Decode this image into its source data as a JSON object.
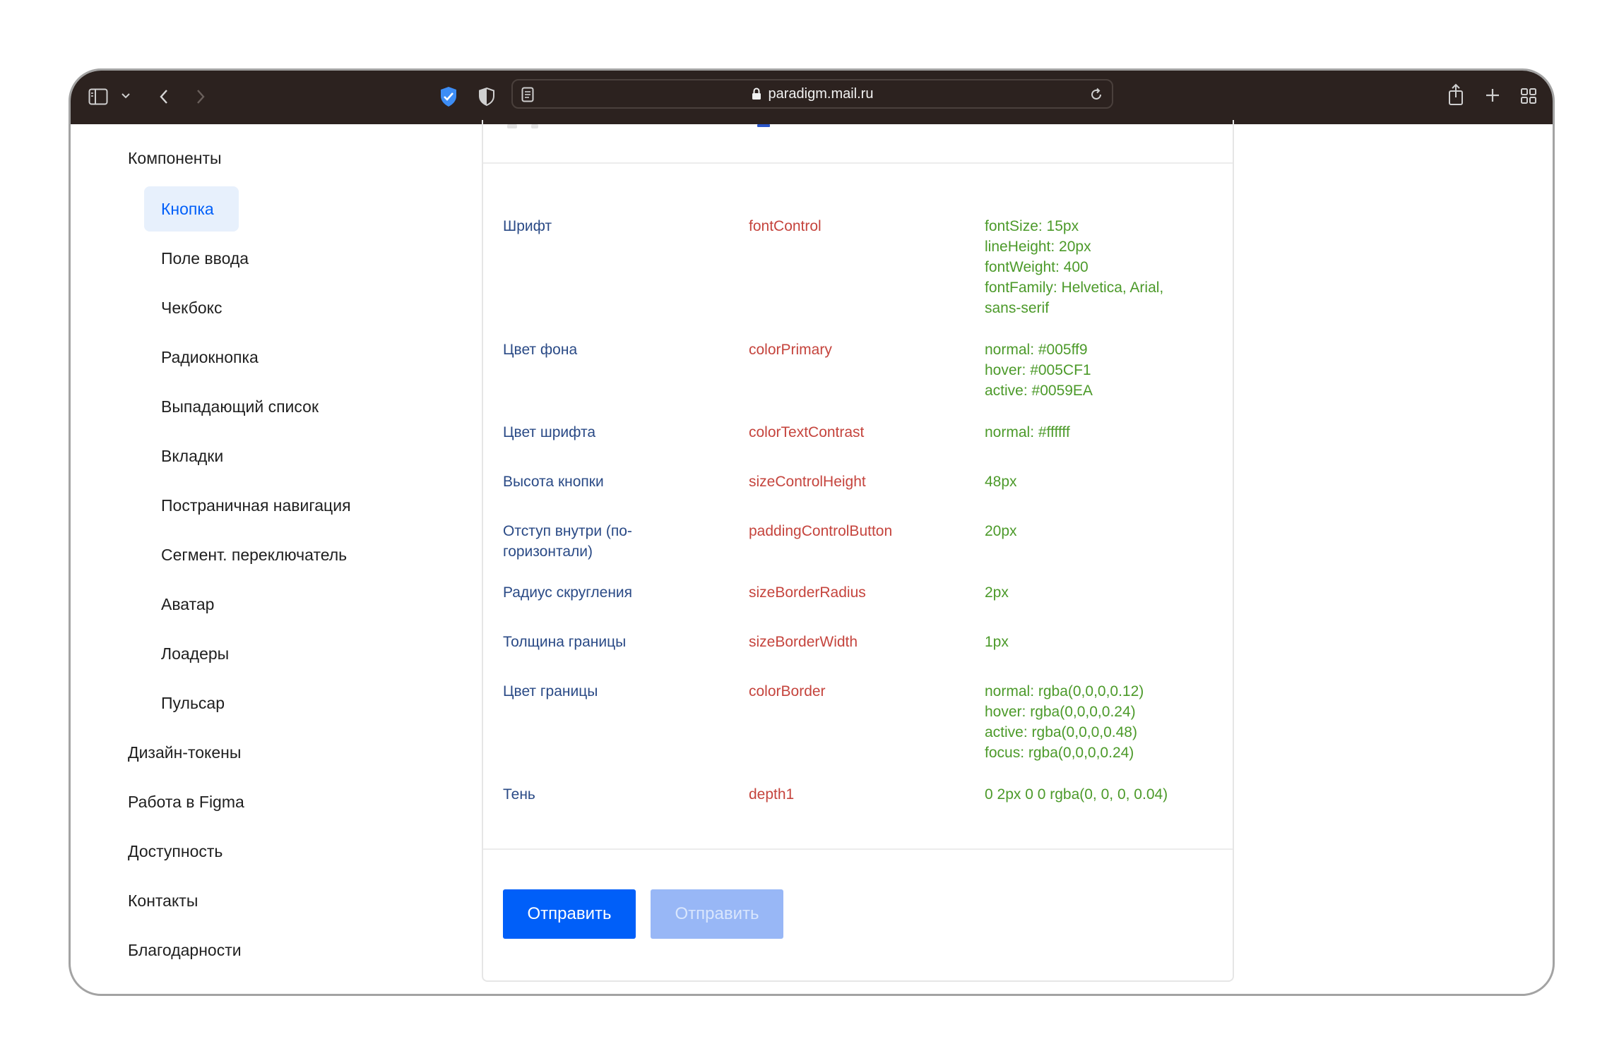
{
  "browser": {
    "url": "paradigm.mail.ru",
    "icons": [
      "sidebar-icon",
      "chevron-down-icon",
      "back-icon",
      "forward-icon",
      "shield-check-icon",
      "privacy-shield-icon",
      "reader-icon",
      "lock-icon",
      "reload-icon",
      "share-icon",
      "new-tab-icon",
      "tab-overview-icon"
    ]
  },
  "sidebar": {
    "section": "Компоненты",
    "items": [
      {
        "label": "Кнопка",
        "active": true
      },
      {
        "label": "Поле ввода"
      },
      {
        "label": "Чекбокс"
      },
      {
        "label": "Радиокнопка"
      },
      {
        "label": "Выпадающий список"
      },
      {
        "label": "Вкладки"
      },
      {
        "label": "Постраничная навигация"
      },
      {
        "label": "Сегмент. переключатель"
      },
      {
        "label": "Аватар"
      },
      {
        "label": "Лоадеры"
      },
      {
        "label": "Пульсар"
      }
    ],
    "sections": [
      "Дизайн-токены",
      "Работа в Figma",
      "Доступность",
      "Контакты",
      "Благодарности"
    ]
  },
  "tokens": {
    "rows": [
      {
        "label": "Шрифт",
        "token": "fontControl",
        "values": [
          "fontSize: 15px",
          "lineHeight: 20px",
          "fontWeight: 400",
          "fontFamily: Helvetica, Arial,",
          "sans-serif"
        ]
      },
      {
        "label": "Цвет фона",
        "token": "colorPrimary",
        "values": [
          "normal: #005ff9",
          "hover: #005CF1",
          "active: #0059EA"
        ]
      },
      {
        "label": "Цвет шрифта",
        "token": "colorTextContrast",
        "values": [
          "normal: #ffffff"
        ]
      },
      {
        "label": "Высота кнопки",
        "token": "sizeControlHeight",
        "values": [
          "48px"
        ]
      },
      {
        "label": "Отступ внутри (по-",
        "label2": "горизонтали)",
        "token": "paddingControlButton",
        "values": [
          "20px"
        ]
      },
      {
        "label": "Радиус скругления",
        "token": "sizeBorderRadius",
        "values": [
          "2px"
        ]
      },
      {
        "label": "Толщина границы",
        "token": "sizeBorderWidth",
        "values": [
          "1px"
        ]
      },
      {
        "label": "Цвет границы",
        "token": "colorBorder",
        "values": [
          "normal: rgba(0,0,0,0.12)",
          "hover: rgba(0,0,0,0.24)",
          "active: rgba(0,0,0,0.48)",
          "focus: rgba(0,0,0,0.24)"
        ]
      },
      {
        "label": "Тень",
        "token": "depth1",
        "values": [
          "0 2px 0 0 rgba(0, 0, 0, 0.04)"
        ]
      }
    ]
  },
  "buttons": {
    "primary": "Отправить",
    "disabled": "Отправить"
  },
  "colors": {
    "toolbar": "#2c221f",
    "accent": "#005ff9",
    "label": "#2a4a86",
    "token": "#c5443d",
    "value": "#4c9a2a",
    "active_bg": "#e7f0fc"
  }
}
